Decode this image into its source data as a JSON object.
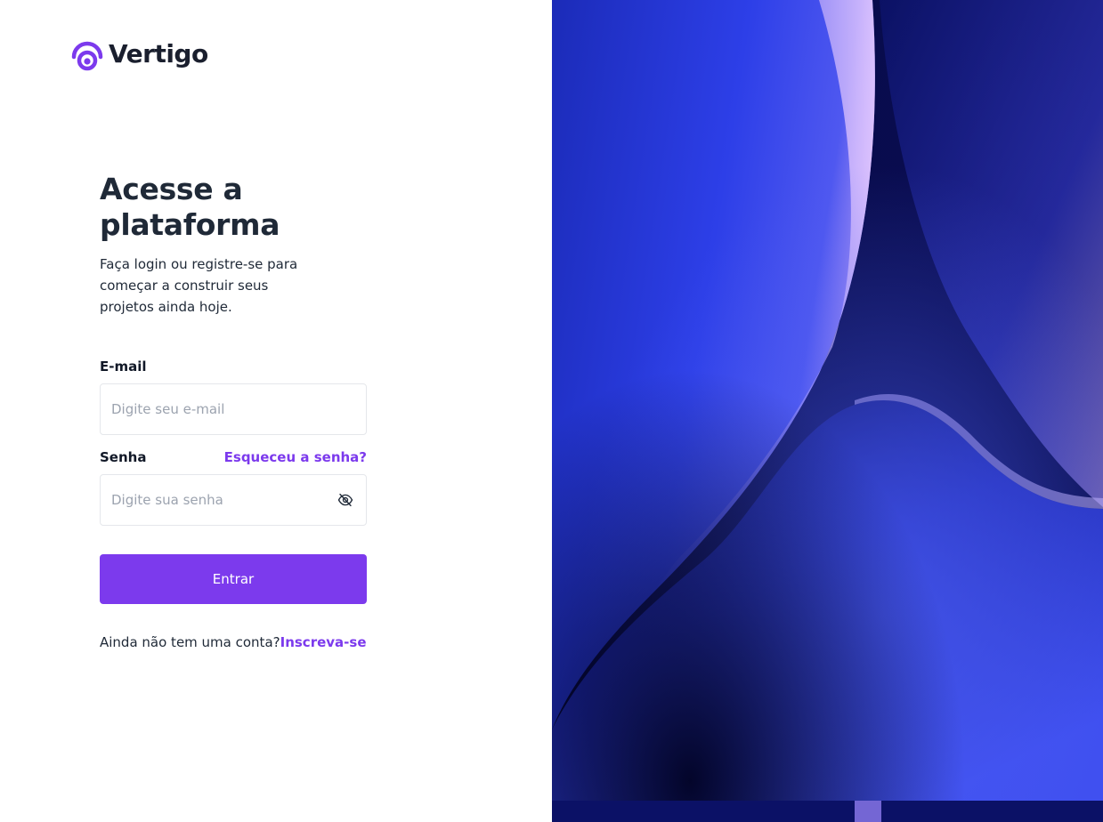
{
  "brand": {
    "name": "Vertigo",
    "accent_color": "#7c3aed",
    "logo_icon": "vertigo-logo-icon"
  },
  "heading": {
    "title": "Acesse a plataforma",
    "subtitle": "Faça login ou registre-se para começar a construir seus projetos ainda hoje."
  },
  "form": {
    "email_label": "E-mail",
    "email_placeholder": "Digite seu e-mail",
    "email_value": "",
    "password_label": "Senha",
    "forgot_link": "Esqueceu a senha?",
    "password_placeholder": "Digite sua senha",
    "password_value": "",
    "password_toggle_icon": "eye-off-icon",
    "submit_label": "Entrar"
  },
  "signup": {
    "prompt": "Ainda não tem uma conta?",
    "link": "Inscreva-se"
  }
}
